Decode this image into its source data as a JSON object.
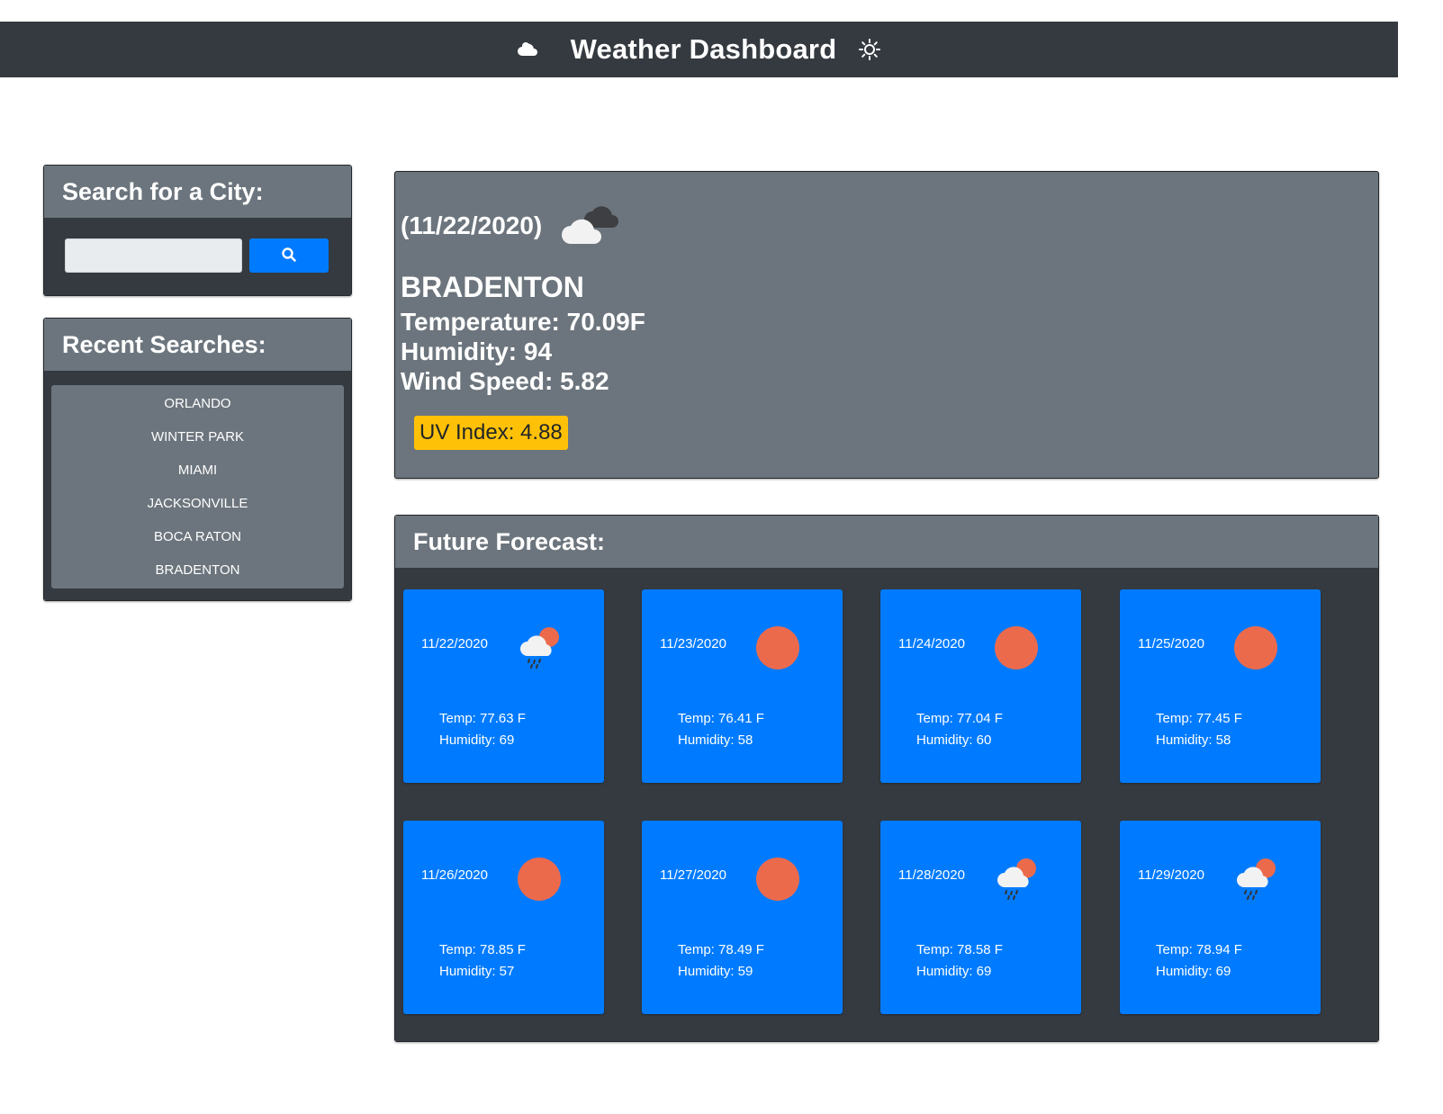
{
  "header": {
    "title": "Weather Dashboard",
    "left_icon": "cloud-icon",
    "right_icon": "sun-icon"
  },
  "search": {
    "heading": "Search for a City:",
    "value": "",
    "button_icon": "search-icon"
  },
  "recent": {
    "heading": "Recent Searches:",
    "items": [
      "ORLANDO",
      "WINTER PARK",
      "MIAMI",
      "JACKSONVILLE",
      "BOCA RATON",
      "BRADENTON"
    ]
  },
  "current": {
    "date": "(11/22/2020)",
    "icon": "broken-clouds-icon",
    "city": "BRADENTON",
    "temperature": "Temperature: 70.09F",
    "humidity": "Humidity: 94",
    "wind": "Wind Speed: 5.82",
    "uv": "UV Index: 4.88",
    "uv_color": "#ffc107"
  },
  "forecast": {
    "heading": "Future Forecast:",
    "days": [
      {
        "date": "11/22/2020",
        "icon": "rain-icon",
        "temp": "Temp: 77.63 F",
        "humidity": "Humidity: 69"
      },
      {
        "date": "11/23/2020",
        "icon": "clear-sun-icon",
        "temp": "Temp: 76.41 F",
        "humidity": "Humidity: 58"
      },
      {
        "date": "11/24/2020",
        "icon": "clear-sun-icon",
        "temp": "Temp: 77.04 F",
        "humidity": "Humidity: 60"
      },
      {
        "date": "11/25/2020",
        "icon": "clear-sun-icon",
        "temp": "Temp: 77.45 F",
        "humidity": "Humidity: 58"
      },
      {
        "date": "11/26/2020",
        "icon": "clear-sun-icon",
        "temp": "Temp: 78.85 F",
        "humidity": "Humidity: 57"
      },
      {
        "date": "11/27/2020",
        "icon": "clear-sun-icon",
        "temp": "Temp: 78.49 F",
        "humidity": "Humidity: 59"
      },
      {
        "date": "11/28/2020",
        "icon": "rain-icon",
        "temp": "Temp: 78.58 F",
        "humidity": "Humidity: 69"
      },
      {
        "date": "11/29/2020",
        "icon": "rain-icon",
        "temp": "Temp: 78.94 F",
        "humidity": "Humidity: 69"
      }
    ]
  },
  "colors": {
    "navbar": "#343a40",
    "panel_head": "#6c757d",
    "accent": "#007bff",
    "sun": "#ec6a4c"
  }
}
